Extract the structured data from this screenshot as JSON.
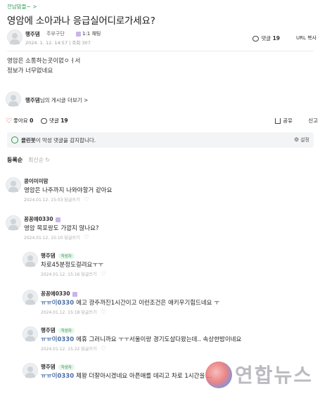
{
  "post": {
    "board_link": "전남맘들~ >",
    "title": "영암에 소아과나 응급실어디로가세요?",
    "author_name": "행주댐",
    "author_role": "주부구단",
    "chat_label": "1:1 채팅",
    "meta": "2024. 1. 12. 14:57 | 조회 307",
    "comment_label": "댓글",
    "comment_count": "19",
    "url_copy": "URL 복사",
    "body_lines": [
      "영암은 소통하는곳이없ㅇㅓ서",
      "정보가 너무없네요"
    ],
    "author_box_name": "행주댐",
    "author_box_suffix": "님의 게시글 더보기 >"
  },
  "actions": {
    "like_label": "좋아요",
    "like_count": "0",
    "reply_label": "댓글",
    "reply_count": "19",
    "share_label": "공유",
    "report_label": "신고"
  },
  "cleanbot": {
    "name": "클린봇",
    "text": "이 악성 댓글을 감지합니다.",
    "setting_label": "설정"
  },
  "sort": {
    "active": "등록순",
    "inactive": "최신순"
  },
  "comments": [
    {
      "name": "콩이미미맘",
      "text": "영암은 나주까지 나와야할거 같아요",
      "meta": "2024.01.12. 15:03 답글쓰기"
    },
    {
      "name": "꽁꽁예0330",
      "text": "영암 목포랑도 가깝지 않나요?",
      "meta": "2024.01.12. 15:10 답글쓰기"
    }
  ],
  "replies": [
    {
      "name": "행주댐",
      "tag": "작성자",
      "reply_to": "",
      "text": "차로45분정도걸려요ㅜㅜ",
      "meta": "2024.01.12. 15:16 답글쓰기"
    },
    {
      "name": "꽁꽁예0330",
      "tag": "",
      "reply_to": "ㅠㅠ이0330",
      "text": "에고 광주까진1시간이고 이런조건은 애키우기힘드네요 ㅜ",
      "meta": "2024.01.12. 15:18 답글쓰기"
    },
    {
      "name": "행주댐",
      "tag": "작성자",
      "reply_to": "ㅠㅠ이0330",
      "text": "에휴 그러니까요 ㅜㅜ서울이랑 경기도살다왔는데.. 속상한밤이네요",
      "meta": "2024.01.12. 15:22 답글쓰기"
    },
    {
      "name": "행주댐",
      "tag": "작성자",
      "reply_to": "ㅠㅠ이0330",
      "text": "제왕 더잘아시겠네요 아픈애를 데리고 차로 1시간을 ...",
      "meta": ""
    }
  ],
  "watermark": {
    "text": "연합뉴스"
  },
  "colors": {
    "accent_green": "#2e9a52",
    "heart_red": "#d04545",
    "reply_blue": "#4a6fa5"
  }
}
